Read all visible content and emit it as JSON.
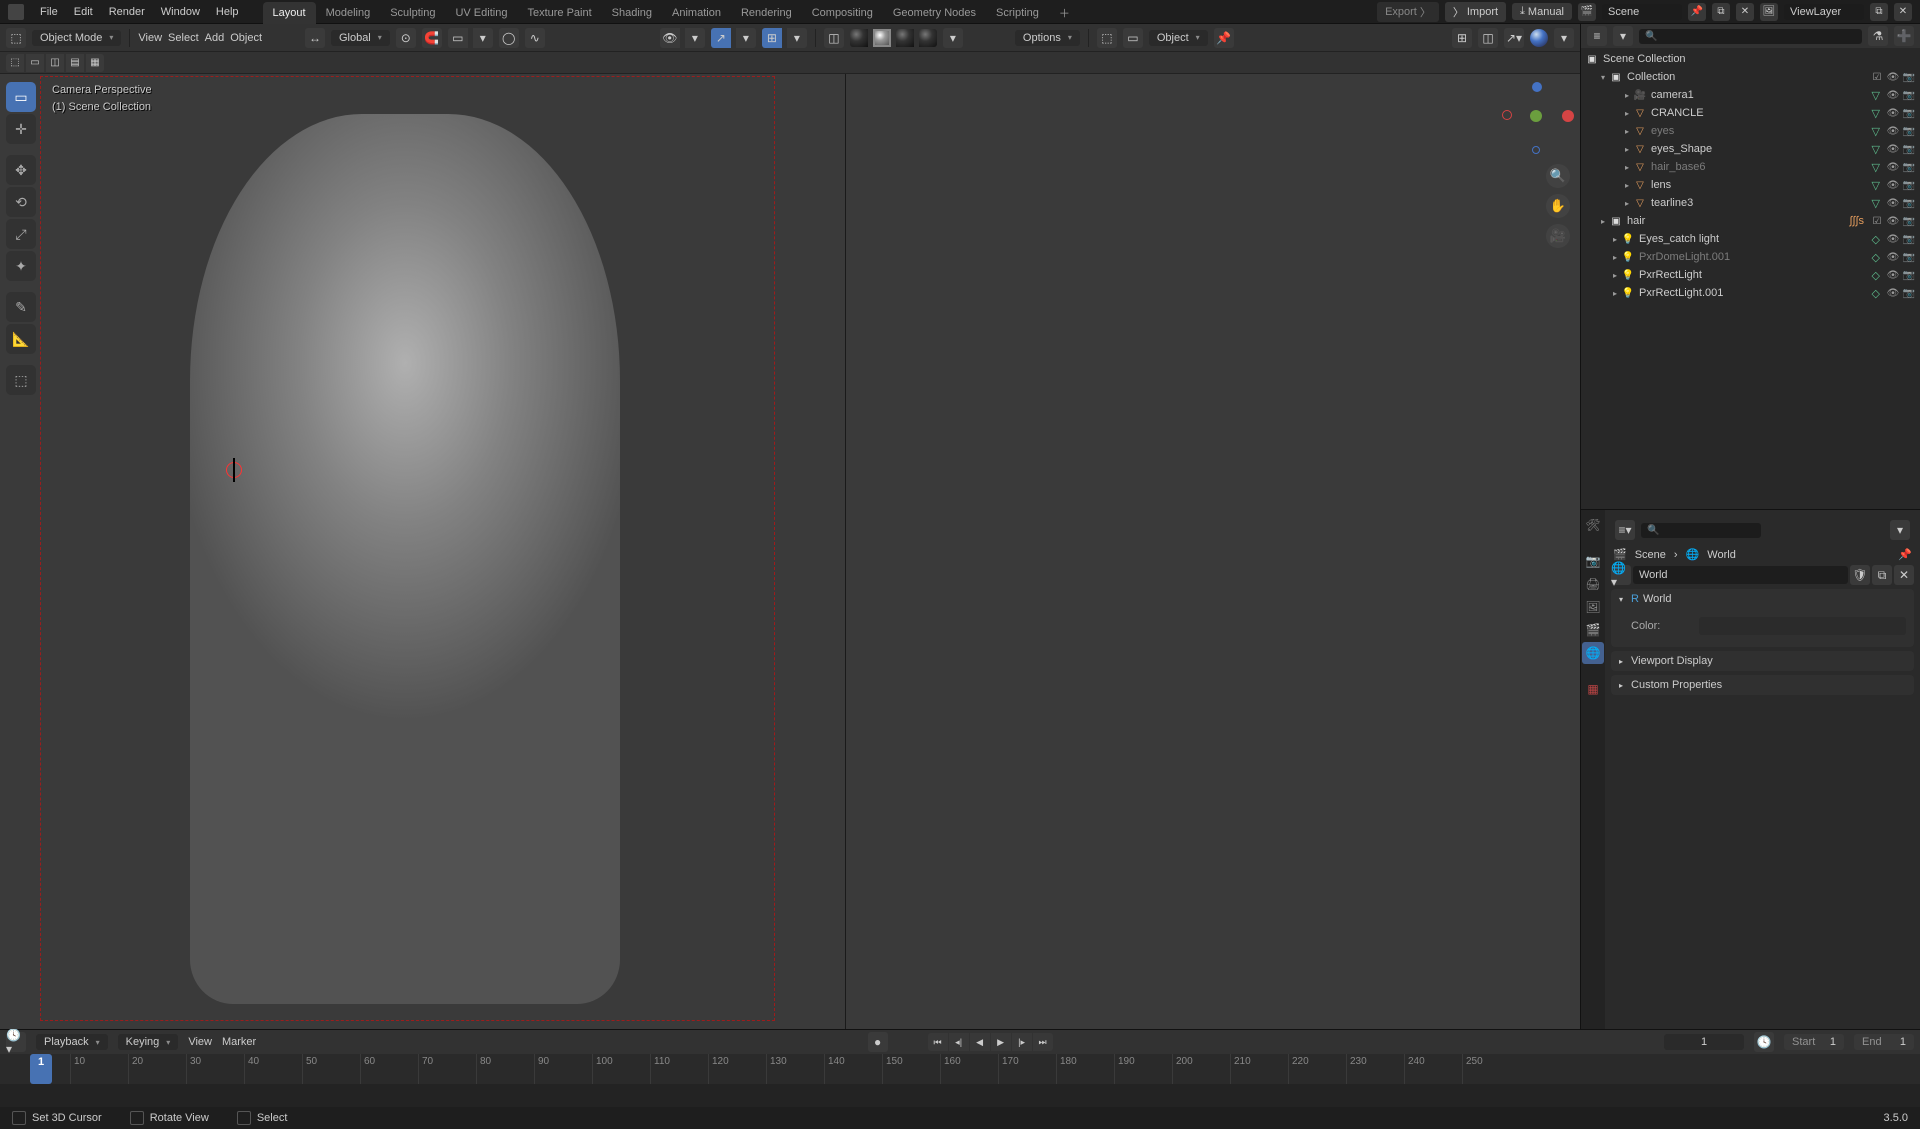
{
  "menubar": {
    "file": "File",
    "edit": "Edit",
    "render": "Render",
    "window": "Window",
    "help": "Help"
  },
  "workspaces": [
    "Layout",
    "Modeling",
    "Sculpting",
    "UV Editing",
    "Texture Paint",
    "Shading",
    "Animation",
    "Rendering",
    "Compositing",
    "Geometry Nodes",
    "Scripting"
  ],
  "workspace_active": "Layout",
  "top_right": {
    "export": "Export",
    "import": "Import",
    "manual": "Manual",
    "scene": "Scene",
    "viewlayer": "ViewLayer"
  },
  "viewport_header": {
    "mode": "Object Mode",
    "view": "View",
    "select": "Select",
    "add": "Add",
    "object": "Object",
    "orientation": "Global",
    "options": "Options"
  },
  "second_header": {
    "object": "Object"
  },
  "overlay": {
    "line1": "Camera Perspective",
    "line2": "(1) Scene Collection"
  },
  "outliner": {
    "scene_collection": "Scene Collection",
    "collection": "Collection",
    "items": [
      {
        "label": "camera1",
        "icon": "cam",
        "depth": 2
      },
      {
        "label": "CRANCLE",
        "icon": "mesh",
        "depth": 2
      },
      {
        "label": "eyes",
        "icon": "mesh",
        "depth": 2,
        "dim": true
      },
      {
        "label": "eyes_Shape",
        "icon": "mesh",
        "depth": 2
      },
      {
        "label": "hair_base6",
        "icon": "mesh",
        "depth": 2,
        "dim": true
      },
      {
        "label": "lens",
        "icon": "mesh",
        "depth": 2
      },
      {
        "label": "tearline3",
        "icon": "mesh",
        "depth": 2
      }
    ],
    "hair": "hair",
    "siblings": [
      {
        "label": "Eyes_catch light",
        "icon": "light",
        "depth": 1
      },
      {
        "label": "PxrDomeLight.001",
        "icon": "light",
        "depth": 1,
        "dim": true
      },
      {
        "label": "PxrRectLight",
        "icon": "light",
        "depth": 1
      },
      {
        "label": "PxrRectLight.001",
        "icon": "light",
        "depth": 1
      }
    ]
  },
  "properties": {
    "breadcrumb_scene": "Scene",
    "breadcrumb_world": "World",
    "world_datablock": "World",
    "panel_world": "World",
    "color_label": "Color:",
    "panel_viewport_display": "Viewport Display",
    "panel_custom_properties": "Custom Properties"
  },
  "timeline": {
    "playback": "Playback",
    "keying": "Keying",
    "view": "View",
    "marker": "Marker",
    "current": 1,
    "start_label": "Start",
    "start": 1,
    "end_label": "End",
    "end": 1,
    "ticks": [
      10,
      20,
      30,
      40,
      50,
      60,
      70,
      80,
      90,
      100,
      110,
      120,
      130,
      140,
      150,
      160,
      170,
      180,
      190,
      200,
      210,
      220,
      230,
      240,
      250
    ]
  },
  "status": {
    "hint1": "Set 3D Cursor",
    "hint2": "Rotate View",
    "hint3": "Select",
    "version": "3.5.0"
  }
}
